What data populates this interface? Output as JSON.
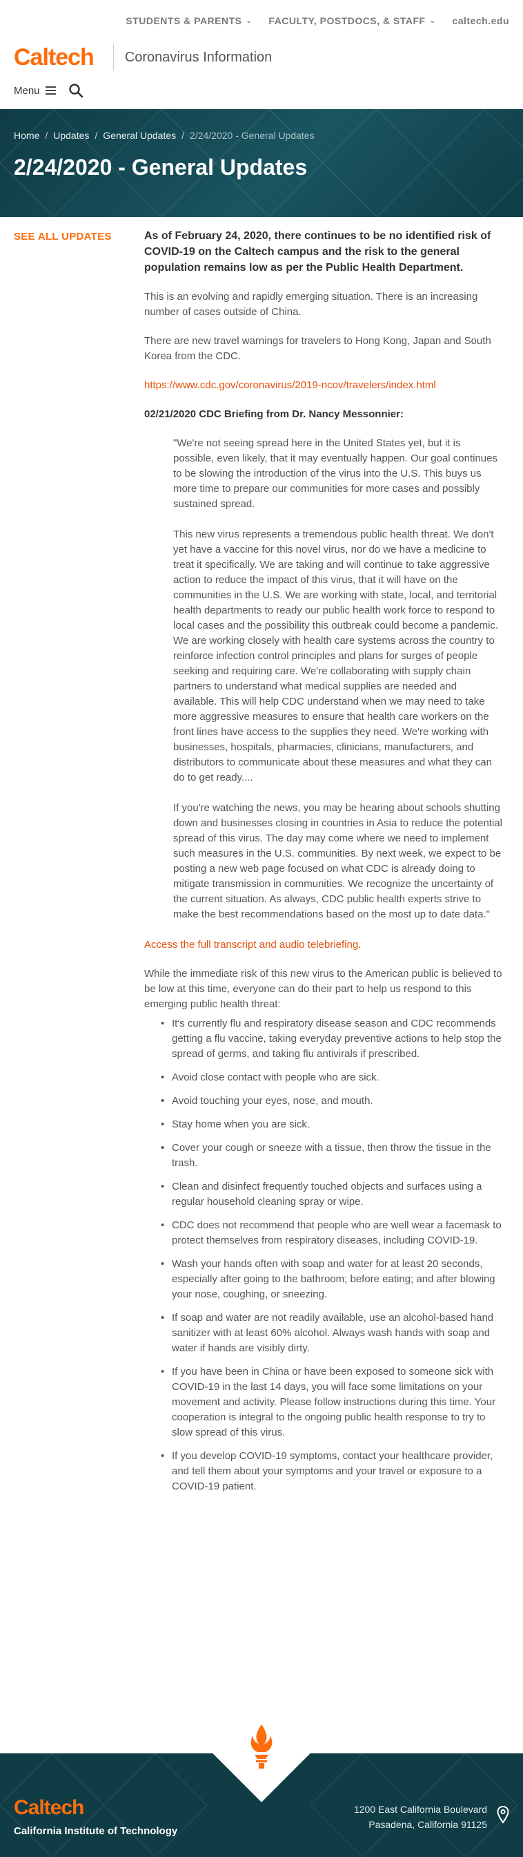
{
  "top_nav": {
    "items": [
      {
        "label": "STUDENTS & PARENTS",
        "has_dropdown": true
      },
      {
        "label": "FACULTY, POSTDOCS, & STAFF",
        "has_dropdown": true
      },
      {
        "label": "caltech.edu",
        "has_dropdown": false
      }
    ]
  },
  "brand": {
    "logo": "Caltech",
    "subtitle": "Coronavirus Information"
  },
  "menu": {
    "label": "Menu",
    "icons": [
      "hamburger-icon",
      "search-icon"
    ]
  },
  "hero": {
    "breadcrumb": [
      "Home",
      "Updates",
      "General Updates",
      "2/24/2020 - General Updates"
    ],
    "title": "2/24/2020 - General Updates"
  },
  "sidebar": {
    "see_all_label": "SEE ALL UPDATES"
  },
  "content": {
    "lead": "As of February 24, 2020, there continues to be no identified risk of COVID-19 on the Caltech campus and the risk to the general population remains low as per the Public Health Department.",
    "para1": "This is an evolving and rapidly emerging situation. There is an increasing number of cases outside of China.",
    "para2": "There are new travel warnings for travelers to Hong Kong, Japan and South Korea from the CDC.",
    "cdc_link": "https://www.cdc.gov/coronavirus/2019-ncov/travelers/index.html",
    "briefing_heading": "02/21/2020 CDC Briefing from Dr. Nancy Messonnier:",
    "quote1": "\"We're not seeing spread here in the United States yet, but it is possible, even likely, that it may eventually happen. Our goal continues to be slowing the introduction of the virus into the U.S. This buys us more time to prepare our communities for more cases and possibly sustained spread.",
    "quote2": "This new virus represents a tremendous public health threat. We don't yet have a vaccine for this novel virus, nor do we have a medicine to treat it specifically. We are taking and will continue to take aggressive action to reduce the impact of this virus, that it will have on the communities in the U.S. We are working with state, local, and territorial health departments to ready our public health work force to respond to local cases and the possibility this outbreak could become a pandemic. We are working closely with health care systems across the country to reinforce infection control principles and plans for surges of people seeking and requiring care. We're collaborating with supply chain partners to understand what medical supplies are needed and available. This will help CDC understand when we may need to take more aggressive measures to ensure that health care workers on the front lines have access to the supplies they need. We're working with businesses, hospitals, pharmacies, clinicians, manufacturers, and distributors to communicate about these measures and what they can do to get ready....",
    "quote3": "If you're watching the news, you may be hearing about schools shutting down and businesses closing in countries in Asia to reduce the potential spread of this virus. The day may come where we need to implement such measures in the U.S. communities. By next week, we expect to be posting a new web page focused on what CDC is already doing to mitigate transmission in communities. We recognize the uncertainty of the current situation. As always, CDC public health experts strive to make the best recommendations based on the most up to date data.\"",
    "transcript_link": "Access the full transcript and audio telebriefing.",
    "para3": "While the immediate risk of this new virus to the American public is believed to be low at this time, everyone can do their part to help us respond to this emerging public health threat:",
    "tips": [
      "It's currently flu and respiratory disease season and CDC recommends getting a flu vaccine, taking everyday preventive actions to help stop the spread of germs, and taking flu antivirals if prescribed.",
      "Avoid close contact with people who are sick.",
      "Avoid touching your eyes, nose, and mouth.",
      "Stay home when you are sick.",
      "Cover your cough or sneeze with a tissue, then throw the tissue in the trash.",
      "Clean and disinfect frequently touched objects and surfaces using a regular household cleaning spray or wipe.",
      "CDC does not recommend that people who are well wear a facemask to protect themselves from respiratory diseases, including COVID-19.",
      "Wash your hands often with soap and water for at least 20 seconds, especially after going to the bathroom; before eating; and after blowing your nose, coughing, or sneezing.",
      "If soap and water are not readily available, use an alcohol-based hand sanitizer with at least 60% alcohol. Always wash hands with soap and water if hands are visibly dirty.",
      "If you have been in China or have been exposed to someone sick with COVID-19 in the last 14 days, you will face some limitations on your movement and activity. Please follow instructions during this time. Your cooperation is integral to the ongoing public health response to try to slow spread of this virus.",
      "If you develop COVID-19 symptoms, contact your healthcare provider, and tell them about your symptoms and your travel or exposure to a COVID-19 patient."
    ]
  },
  "footer": {
    "logo": "Caltech",
    "institution": "California Institute of Technology",
    "address_line1": "1200 East California Boulevard",
    "address_line2": "Pasadena, California 91125"
  },
  "colors": {
    "brand_orange": "#ff6c0c",
    "link_orange": "#e4500b",
    "hero_teal": "#0f3c45",
    "footer_teal": "#0f3c45"
  }
}
